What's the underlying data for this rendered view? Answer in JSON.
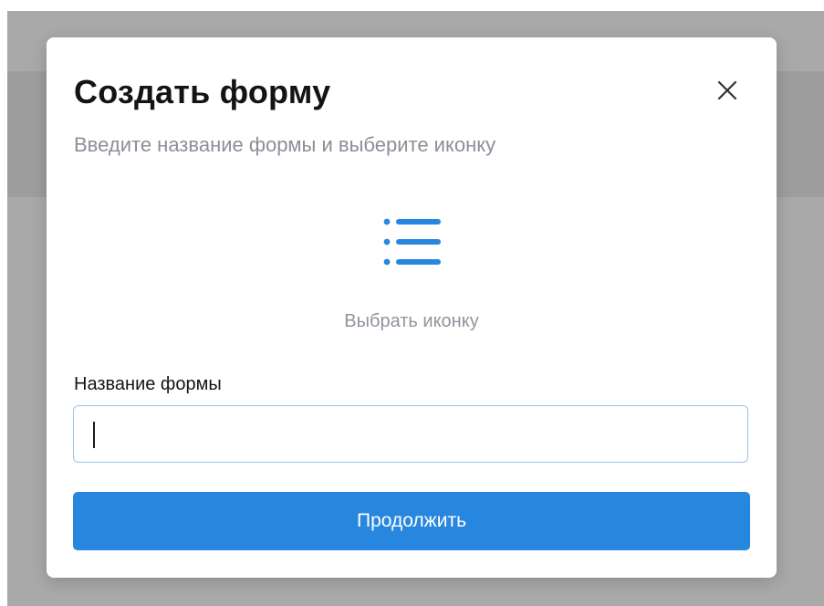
{
  "modal": {
    "title": "Создать форму",
    "subtitle": "Введите название формы и выберите иконку",
    "close_icon": "close-icon",
    "icon_picker": {
      "icon": "list-icon",
      "label": "Выбрать иконку"
    },
    "form_name": {
      "label": "Название формы",
      "value": "",
      "placeholder": ""
    },
    "continue_label": "Продолжить"
  },
  "colors": {
    "accent": "#2787de",
    "overlay": "#a9a9a9",
    "muted_text": "#8a8f98",
    "input_border": "#9bc3ea"
  }
}
